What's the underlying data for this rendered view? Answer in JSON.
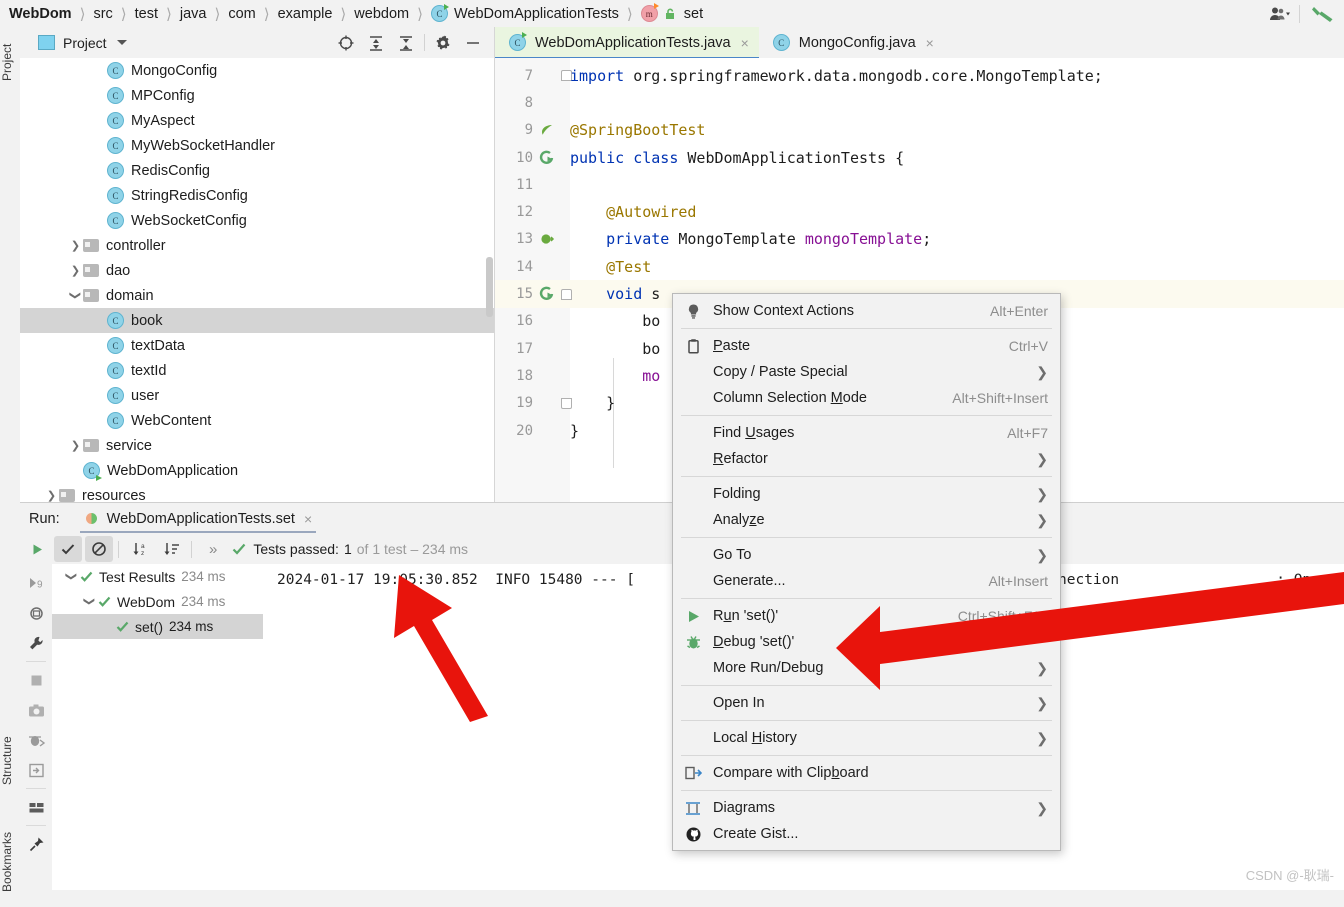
{
  "breadcrumb": {
    "items": [
      {
        "label": "WebDom",
        "icon": null,
        "bold": true
      },
      {
        "label": "src",
        "icon": null
      },
      {
        "label": "test",
        "icon": null
      },
      {
        "label": "java",
        "icon": null
      },
      {
        "label": "com",
        "icon": null
      },
      {
        "label": "example",
        "icon": null
      },
      {
        "label": "webdom",
        "icon": null
      },
      {
        "label": "WebDomApplicationTests",
        "icon": "class-icon"
      },
      {
        "label": "set",
        "icon": "method-icon"
      }
    ],
    "right_icons": [
      "user-account-icon",
      "chevron-down-icon",
      "build-hammer-icon"
    ]
  },
  "left_strip": {
    "project_label": "Project",
    "structure_label": "Structure",
    "bookmarks_label": "Bookmarks"
  },
  "project_panel": {
    "title": "Project",
    "icons": [
      "locate-target-icon",
      "expand-all-icon",
      "collapse-all-icon",
      "gear-icon",
      "minimize-icon"
    ],
    "tree": [
      {
        "label": "MongoConfig",
        "type": "class",
        "indent": 3
      },
      {
        "label": "MPConfig",
        "type": "class",
        "indent": 3
      },
      {
        "label": "MyAspect",
        "type": "class",
        "indent": 3
      },
      {
        "label": "MyWebSocketHandler",
        "type": "class",
        "indent": 3
      },
      {
        "label": "RedisConfig",
        "type": "class",
        "indent": 3
      },
      {
        "label": "StringRedisConfig",
        "type": "class",
        "indent": 3
      },
      {
        "label": "WebSocketConfig",
        "type": "class",
        "indent": 3
      },
      {
        "label": "controller",
        "type": "folder",
        "indent": 2,
        "arrow": "collapsed"
      },
      {
        "label": "dao",
        "type": "folder",
        "indent": 2,
        "arrow": "collapsed"
      },
      {
        "label": "domain",
        "type": "folder",
        "indent": 2,
        "arrow": "expanded"
      },
      {
        "label": "book",
        "type": "class",
        "indent": 3,
        "selected": true
      },
      {
        "label": "textData",
        "type": "class",
        "indent": 3
      },
      {
        "label": "textId",
        "type": "class",
        "indent": 3
      },
      {
        "label": "user",
        "type": "class",
        "indent": 3
      },
      {
        "label": "WebContent",
        "type": "class",
        "indent": 3
      },
      {
        "label": "service",
        "type": "folder",
        "indent": 2,
        "arrow": "collapsed"
      },
      {
        "label": "WebDomApplication",
        "type": "runnable-class",
        "indent": 2
      },
      {
        "label": "resources",
        "type": "folder",
        "indent": 1,
        "arrow": "collapsed"
      }
    ]
  },
  "editor": {
    "tabs": [
      {
        "label": "WebDomApplicationTests.java",
        "icon": "test-class-icon",
        "active": true,
        "close": "×"
      },
      {
        "label": "MongoConfig.java",
        "icon": "class-icon",
        "active": false,
        "close": "×"
      }
    ],
    "lines": [
      {
        "num": "7",
        "gutter": null,
        "fold": "top",
        "current": false,
        "tokens": [
          {
            "t": "import ",
            "c": "kw"
          },
          {
            "t": "org.springframework.data.mongodb.core.MongoTemplate;",
            "c": "pl"
          }
        ]
      },
      {
        "num": "8",
        "gutter": null,
        "current": false,
        "tokens": []
      },
      {
        "num": "9",
        "gutter": "spring-leaf-icon",
        "current": false,
        "tokens": [
          {
            "t": "@SpringBootTest",
            "c": "ann"
          }
        ]
      },
      {
        "num": "10",
        "gutter": "run-class-icon",
        "current": false,
        "tokens": [
          {
            "t": "public ",
            "c": "kw"
          },
          {
            "t": "class ",
            "c": "kw"
          },
          {
            "t": "WebDomApplicationTests {",
            "c": "pl"
          }
        ]
      },
      {
        "num": "11",
        "gutter": null,
        "current": false,
        "tokens": []
      },
      {
        "num": "12",
        "gutter": null,
        "current": false,
        "tokens": [
          {
            "t": "    @Autowired",
            "c": "ann"
          }
        ]
      },
      {
        "num": "13",
        "gutter": "bean-icon",
        "current": false,
        "tokens": [
          {
            "t": "    private ",
            "c": "kw"
          },
          {
            "t": "MongoTemplate ",
            "c": "pl"
          },
          {
            "t": "mongoTemplate",
            "c": "fld"
          },
          {
            "t": ";",
            "c": "pl"
          }
        ]
      },
      {
        "num": "14",
        "gutter": null,
        "current": false,
        "tokens": [
          {
            "t": "    @Test",
            "c": "ann"
          }
        ]
      },
      {
        "num": "15",
        "gutter": "run-test-icon",
        "fold": "top",
        "current": true,
        "tokens": [
          {
            "t": "    void ",
            "c": "kw"
          },
          {
            "t": "s",
            "c": "pl"
          }
        ]
      },
      {
        "num": "16",
        "gutter": null,
        "current": false,
        "tokens": [
          {
            "t": "        bo",
            "c": "pl"
          }
        ]
      },
      {
        "num": "17",
        "gutter": null,
        "current": false,
        "tokens": [
          {
            "t": "        bo",
            "c": "pl"
          }
        ]
      },
      {
        "num": "18",
        "gutter": null,
        "current": false,
        "tokens": [
          {
            "t": "        mo",
            "c": "fld"
          }
        ]
      },
      {
        "num": "19",
        "gutter": null,
        "fold": "bottom",
        "current": false,
        "tokens": [
          {
            "t": "    }",
            "c": "pl"
          }
        ]
      },
      {
        "num": "20",
        "gutter": null,
        "current": false,
        "tokens": [
          {
            "t": "}",
            "c": "pl"
          }
        ]
      }
    ]
  },
  "context_menu": {
    "groups": [
      [
        {
          "label": "Show Context Actions",
          "icon": "lightbulb-icon",
          "shortcut": "Alt+Enter"
        }
      ],
      [
        {
          "label": "Paste",
          "mnemonic": "P",
          "icon": "clipboard-icon",
          "shortcut": "Ctrl+V"
        },
        {
          "label": "Copy / Paste Special",
          "submenu": true
        },
        {
          "label": "Column Selection Mode",
          "mnemonic": "M",
          "shortcut": "Alt+Shift+Insert"
        }
      ],
      [
        {
          "label": "Find Usages",
          "mnemonic": "U",
          "shortcut": "Alt+F7"
        },
        {
          "label": "Refactor",
          "mnemonic": "R",
          "submenu": true
        }
      ],
      [
        {
          "label": "Folding",
          "submenu": true
        },
        {
          "label": "Analyze",
          "mnemonic": "z",
          "submenu": true
        }
      ],
      [
        {
          "label": "Go To",
          "submenu": true
        },
        {
          "label": "Generate...",
          "shortcut": "Alt+Insert"
        }
      ],
      [
        {
          "label": "Run 'set()'",
          "mnemonic": "u",
          "icon": "run-green-icon",
          "shortcut": "Ctrl+Shift+F10"
        },
        {
          "label": "Debug 'set()'",
          "mnemonic": "D",
          "icon": "debug-bug-icon"
        },
        {
          "label": "More Run/Debug",
          "submenu": true
        }
      ],
      [
        {
          "label": "Open In",
          "submenu": true
        }
      ],
      [
        {
          "label": "Local History",
          "mnemonic": "H",
          "submenu": true
        }
      ],
      [
        {
          "label": "Compare with Clipboard",
          "mnemonic": "b",
          "icon": "compare-icon"
        }
      ],
      [
        {
          "label": "Diagrams",
          "icon": "diagram-icon",
          "submenu": true
        },
        {
          "label": "Create Gist...",
          "icon": "github-icon"
        }
      ]
    ]
  },
  "run_panel": {
    "run_label": "Run:",
    "tab_label": "WebDomApplicationTests.set",
    "tab_close": "×",
    "toolbar_icons": [
      "rerun-play-icon",
      "show-passed-icon",
      "hide-ignored-icon",
      "sort-alphabetically-icon",
      "sort-by-duration-icon",
      "expand-chevrons-icon"
    ],
    "status_prefix": "Tests passed:",
    "status_count": "1",
    "status_suffix": "of 1 test – 234 ms",
    "side_icons": [
      "rerun-icon",
      "rerun-auto-icon",
      "settings-wrench-icon",
      "stop-icon",
      "screenshot-icon",
      "debug-icon",
      "export-icon",
      "layout-icon",
      "pin-icon"
    ],
    "test_tree": [
      {
        "label": "Test Results",
        "time": "234 ms",
        "indent": 1,
        "arrow": "expanded",
        "selected": false
      },
      {
        "label": "WebDom",
        "time": "234 ms",
        "indent": 2,
        "arrow": "expanded",
        "selected": false
      },
      {
        "label": "set()",
        "time": "234 ms",
        "indent": 3,
        "arrow": null,
        "selected": true
      }
    ],
    "console_line": "2024-01-17 19:05:30.852  INFO 15480 --- [",
    "console_right": "nection                  : Opened c"
  },
  "watermark": "CSDN @-耿瑞-",
  "colors": {
    "accent_blue": "#4a86c8",
    "active_tab_bg": "#eaf5e0",
    "selection_gray": "#d4d4d4",
    "current_line": "#fcfaef",
    "keyword": "#0033b3",
    "annotation": "#9a7700",
    "field": "#871094",
    "pass_green": "#4caf50",
    "arrow_red": "#e8140c"
  }
}
